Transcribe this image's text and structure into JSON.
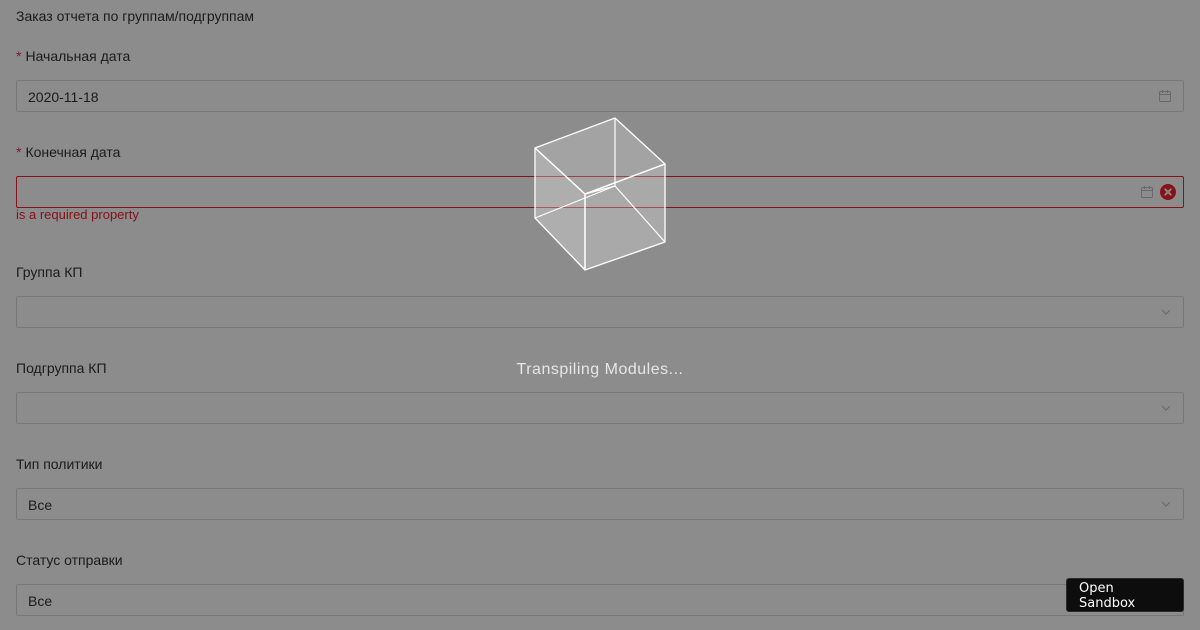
{
  "form": {
    "title": "Заказ отчета по группам/подгруппам",
    "required_mark": "*",
    "start_date": {
      "label": "Начальная дата",
      "value": "2020-11-18",
      "icon": "calendar-icon"
    },
    "end_date": {
      "label": "Конечная дата",
      "value": "",
      "error": "is a required property",
      "icon": "calendar-icon",
      "clear_icon": "close-circle-icon"
    },
    "kp_group": {
      "label": "Группа КП",
      "value": "",
      "icon": "chevron-down-icon"
    },
    "kp_subgroup": {
      "label": "Подгруппа КП",
      "value": "",
      "icon": "chevron-down-icon"
    },
    "policy_type": {
      "label": "Тип политики",
      "value": "Все",
      "icon": "chevron-down-icon"
    },
    "send_status": {
      "label": "Статус отправки",
      "value": "Все",
      "icon": "chevron-down-icon"
    }
  },
  "overlay": {
    "loading_text": "Transpiling Modules...",
    "icon": "cube-icon"
  },
  "open_sandbox_label": "Open Sandbox",
  "colors": {
    "required": "#d9363e",
    "error": "#f5222d",
    "overlay": "rgba(0,0,0,0.45)",
    "sandbox_button": "#0d0d0d"
  }
}
